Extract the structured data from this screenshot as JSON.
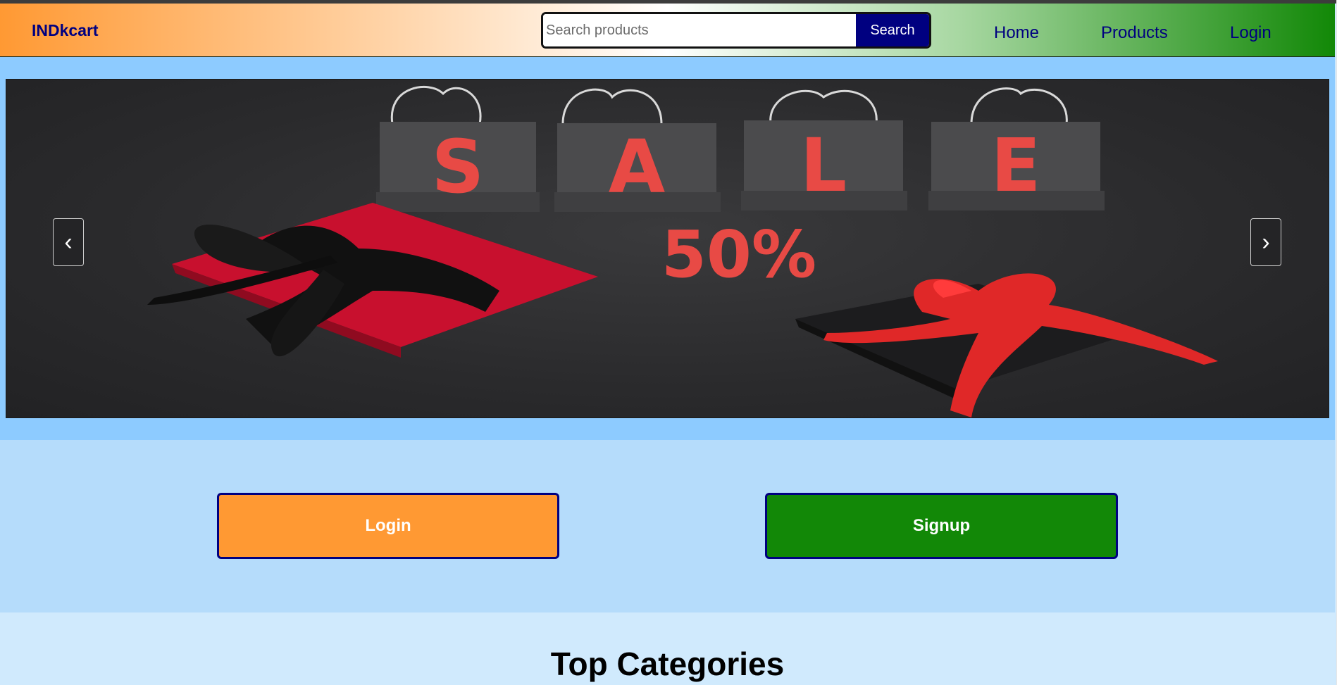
{
  "navbar": {
    "brand": "INDkcart",
    "search_placeholder": "Search products",
    "search_button": "Search",
    "links": [
      {
        "label": "Home"
      },
      {
        "label": "Products"
      },
      {
        "label": "Login"
      }
    ]
  },
  "hero": {
    "banner_letters": [
      "S",
      "A",
      "L",
      "E"
    ],
    "banner_discount": "50%",
    "prev_icon": "chevron-left-icon",
    "next_icon": "chevron-right-icon",
    "prev_glyph": "‹",
    "next_glyph": "›"
  },
  "auth": {
    "login_label": "Login",
    "signup_label": "Signup"
  },
  "categories": {
    "title": "Top Categories"
  },
  "colors": {
    "saffron": "#ff9933",
    "green": "#128807",
    "navy": "#000080",
    "hero_bg": "#8dcbff",
    "auth_bg": "#b5dcfb",
    "sale_red": "#e84a45"
  }
}
